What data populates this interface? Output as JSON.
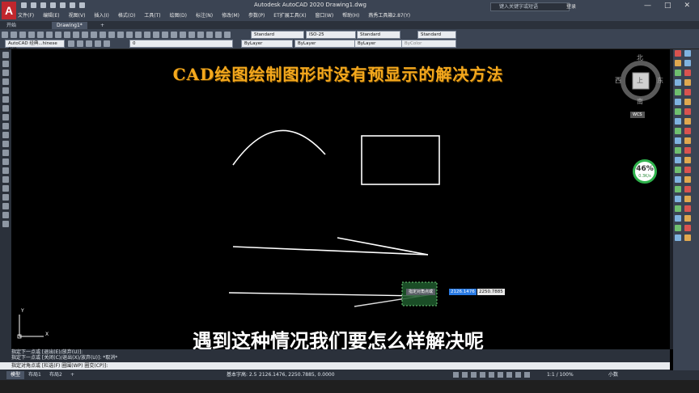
{
  "app": {
    "logo_letter": "A",
    "window_title": "Autodesk AutoCAD 2020    Drawing1.dwg",
    "search_placeholder": "键入关键字或短语",
    "user_label": "登录",
    "window_buttons": [
      "—",
      "□",
      "✕"
    ]
  },
  "menu": [
    "文件(F)",
    "编辑(E)",
    "视图(V)",
    "插入(I)",
    "格式(O)",
    "工具(T)",
    "绘图(D)",
    "标注(N)",
    "修改(M)",
    "参数(P)",
    "ET扩展工具(X)",
    "窗口(W)",
    "帮助(H)",
    "燕秀工具箱2.87(Y)"
  ],
  "tabs": {
    "start": "开始",
    "drawing": "Drawing1*",
    "add": "+"
  },
  "toolbar": {
    "workspace": "AutoCAD 经典...hinese 标准",
    "layer": "0",
    "text_style": "Standard",
    "dim_style": "ISO-25",
    "table_style": "Standard",
    "multileader_style": "Standard",
    "color": "ByLayer",
    "linetype": "ByLayer",
    "lineweight": "ByLayer",
    "plot_style": "ByColor"
  },
  "overlay": {
    "title": "CAD绘图绘制图形时没有预显示的解决方法",
    "subtitle": "遇到这种情况我们要怎么样解决呢"
  },
  "viewcube": {
    "north": "北",
    "south": "南",
    "east": "东",
    "west": "西",
    "top": "上",
    "wcs": "WCS"
  },
  "perf_widget": {
    "percent": "46%",
    "rate": "0.3K/s"
  },
  "dynamic_input": {
    "prompt": "指定对角点或",
    "x_value": "2126.1476",
    "y_value": "2250.7885"
  },
  "command": {
    "history": [
      "指定下一点或 [退出(E)/放弃(U)]:",
      "指定下一点或 [关闭(C)/退出(X)/放弃(U)]: *取消*"
    ],
    "prompt": "指定对角点或 [栏选(F) 圈围(WP) 圈交(CP)]:"
  },
  "status": {
    "layout_tabs": [
      "模型",
      "布局1",
      "布局2",
      "+"
    ],
    "coords": "2126.1476, 2250.7885, 0.0000",
    "scale": "1:1 / 100%",
    "units": "小数",
    "annotation": "基本字高: 2.5"
  },
  "ucs_labels": {
    "x": "X",
    "y": "Y"
  }
}
